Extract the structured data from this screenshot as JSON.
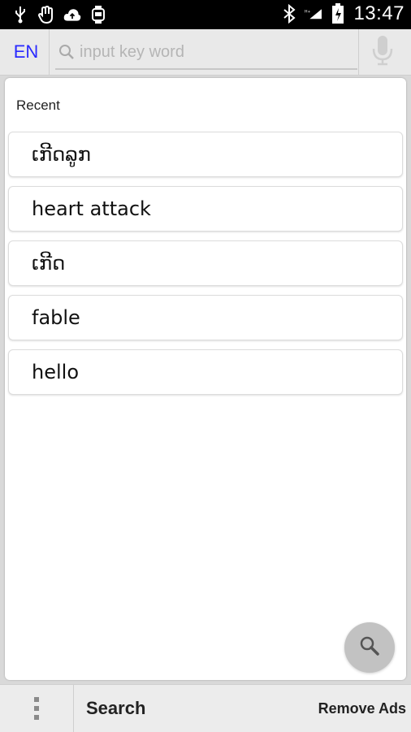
{
  "status_bar": {
    "time": "13:47",
    "icons": [
      "usb-icon",
      "hand-icon",
      "cloud-upload-icon",
      "watch-icon",
      "bluetooth-icon",
      "signal-icon",
      "battery-icon"
    ]
  },
  "header": {
    "language": "EN",
    "search_placeholder": "input key word"
  },
  "recent": {
    "label": "Recent",
    "items": [
      "ເກີດລູກ",
      "heart attack",
      "ເກີດ",
      "fable",
      "hello"
    ]
  },
  "bottom_bar": {
    "title": "Search",
    "remove_ads": "Remove Ads"
  },
  "colors": {
    "accent_language": "#2a2aff",
    "status_bar": "#000000",
    "fab": "#c2c2c2"
  }
}
